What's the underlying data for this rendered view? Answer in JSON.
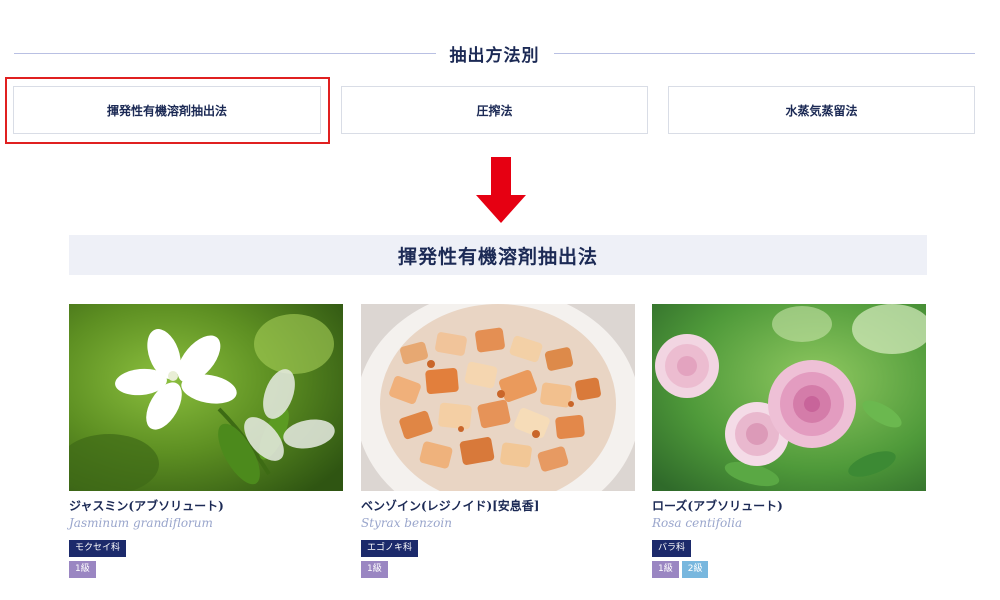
{
  "section": {
    "title": "抽出方法別"
  },
  "methods": [
    {
      "label": "揮発性有機溶剤抽出法"
    },
    {
      "label": "圧搾法"
    },
    {
      "label": "水蒸気蒸留法"
    }
  ],
  "result": {
    "title": "揮発性有機溶剤抽出法"
  },
  "products": [
    {
      "name": "ジャスミン(アブソリュート)",
      "latin": "Jasminum grandiflorum",
      "family": "モクセイ科",
      "levels": [
        "1級"
      ]
    },
    {
      "name": "ベンゾイン(レジノイド)[安息香]",
      "latin": "Styrax benzoin",
      "family": "エゴノキ科",
      "levels": [
        "1級"
      ]
    },
    {
      "name": "ローズ(アブソリュート)",
      "latin": "Rosa centifolia",
      "family": "バラ科",
      "levels": [
        "1級",
        "2級"
      ]
    }
  ],
  "colors": {
    "navy": "#1c2a55",
    "highlight": "#e02020",
    "level1": "#9a86c2",
    "level2": "#78b7de",
    "banner": "#eef0f7"
  }
}
